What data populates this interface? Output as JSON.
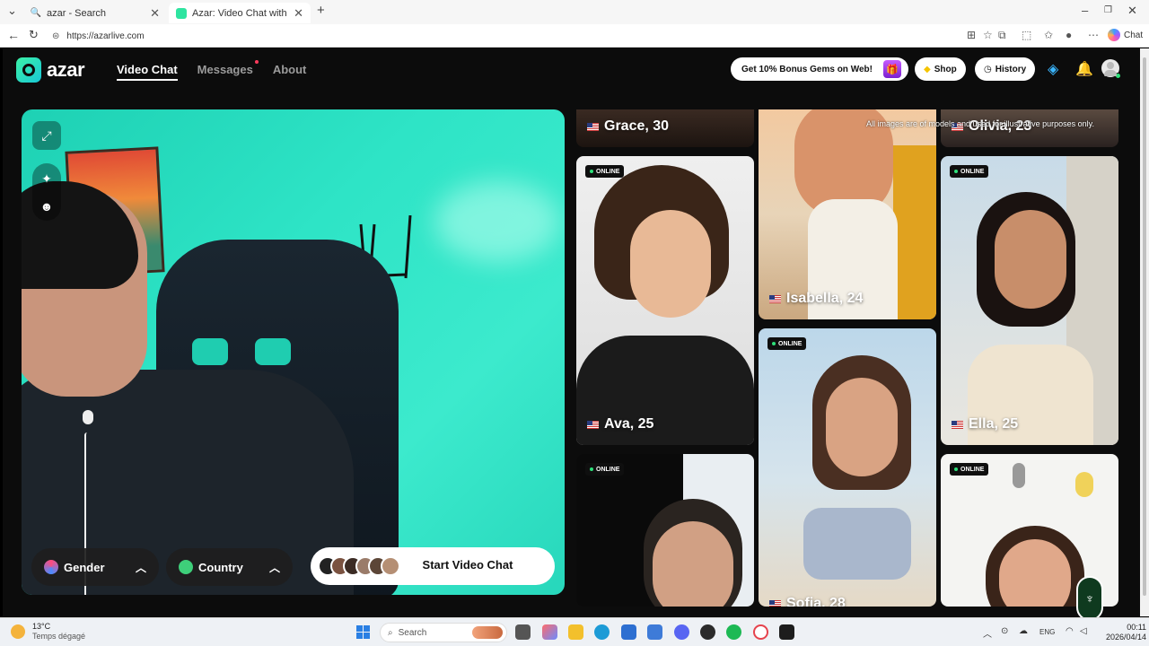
{
  "browser": {
    "tabs": [
      {
        "title": "azar - Search",
        "active": false
      },
      {
        "title": "Azar: Video Chat with New Fri",
        "active": true
      }
    ],
    "new_tab": "+",
    "url": "https://azarlive.com",
    "copilot_label": "Chat"
  },
  "site": {
    "logo": "azar",
    "nav": [
      {
        "label": "Video Chat",
        "active": true
      },
      {
        "label": "Messages",
        "active": false,
        "badge": true
      },
      {
        "label": "About",
        "active": false
      }
    ],
    "promo": "Get 10% Bonus Gems on Web!",
    "shop": "Shop",
    "history": "History",
    "colors": {
      "accent": "#2ee4c6",
      "online": "#2ee07a",
      "background": "#0c0c0c"
    }
  },
  "camera": {
    "gender_label": "Gender",
    "country_label": "Country",
    "start_label": "Start Video Chat"
  },
  "profiles": {
    "disclaimer": "All images are of models and used for illustrative purposes only.",
    "online_badge": "ONLINE",
    "cards": [
      {
        "name": "Grace, 30"
      },
      {
        "name": "Olivia, 23"
      },
      {
        "name": "Isabella, 24"
      },
      {
        "name": "Ava, 25"
      },
      {
        "name": "Ella, 25"
      },
      {
        "name": "Sofia, 28"
      }
    ]
  },
  "taskbar": {
    "weather_temp": "13°C",
    "weather_desc": "Temps dégagé",
    "search_placeholder": "Search",
    "lang": "ENG",
    "time": "00:11",
    "date": "2026/04/14"
  }
}
